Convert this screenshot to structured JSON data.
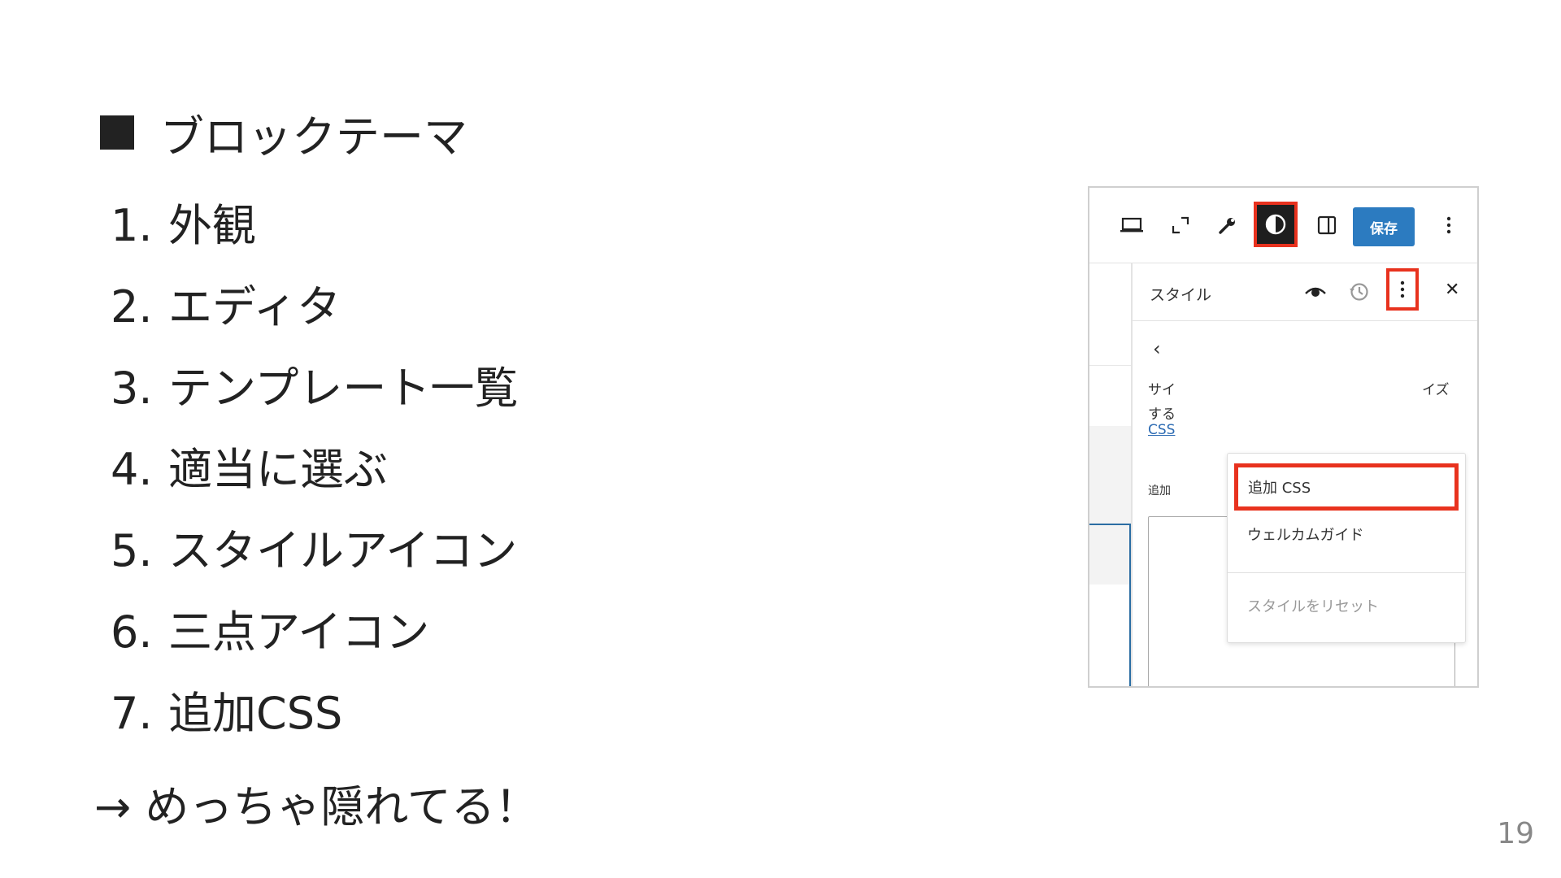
{
  "slide": {
    "heading": "ブロックテーマ",
    "steps": [
      {
        "num": "1.",
        "text": "外観"
      },
      {
        "num": "2.",
        "text": "エディタ"
      },
      {
        "num": "3.",
        "text": "テンプレート一覧"
      },
      {
        "num": "4.",
        "text": "適当に選ぶ"
      },
      {
        "num": "5.",
        "text": "スタイルアイコン"
      },
      {
        "num": "6.",
        "text": "三点アイコン"
      },
      {
        "num": "7.",
        "text": "追加CSS"
      }
    ],
    "conclusion": "→ めっちゃ隠れてる！",
    "page_number": "19"
  },
  "screenshot": {
    "toolbar": {
      "icons": [
        "desktop-view-icon",
        "fullscreen-icon",
        "tools-icon",
        "style-contrast-icon",
        "sidebar-toggle-icon",
        "options-icon"
      ],
      "save_label": "保存"
    },
    "sidebar": {
      "title": "スタイル",
      "icons": [
        "eye-icon",
        "revision-history-icon",
        "more-vertical-icon",
        "close-icon"
      ],
      "close_label": "✕",
      "back_label": "‹",
      "desc_line1": "サイ",
      "desc_line2": "する",
      "desc_tail": "イズ",
      "css_link": "CSS",
      "field_label": "追加"
    },
    "menu": {
      "items": [
        "追加 CSS",
        "ウェルカムガイド",
        "スタイルをリセット"
      ],
      "highlighted": "追加 CSS",
      "disabled": "スタイルをリセット"
    },
    "colors": {
      "highlight_red": "#e8321e",
      "save_blue": "#2c7bc0",
      "link_blue": "#2c6bb3"
    }
  }
}
